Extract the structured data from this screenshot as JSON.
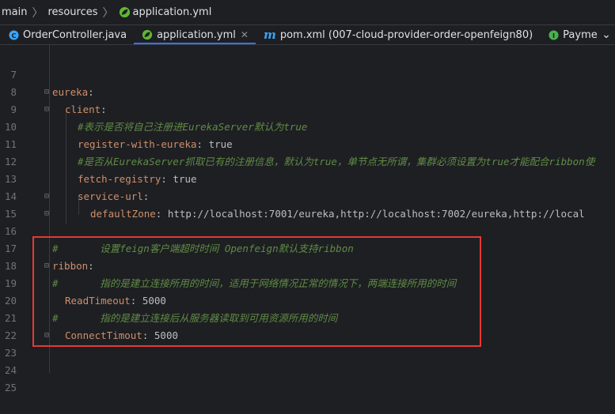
{
  "breadcrumb": {
    "items": [
      "main",
      "resources",
      "application.yml"
    ]
  },
  "tabs": [
    {
      "label": "OrderController.java",
      "icon": "java-class-icon",
      "active": false
    },
    {
      "label": "application.yml",
      "icon": "spring-leaf-icon",
      "active": true
    },
    {
      "label": "pom.xml (007-cloud-provider-order-openfeign80)",
      "icon": "maven-icon",
      "active": false
    },
    {
      "label": "PaymentFeign",
      "icon": "interface-icon",
      "active": false
    }
  ],
  "lines": [
    {
      "n": "7"
    },
    {
      "n": "8"
    },
    {
      "n": "9",
      "key": "eureka",
      "sep": ":"
    },
    {
      "n": "10",
      "key": "client",
      "sep": ":"
    },
    {
      "n": "11",
      "comment": "#表示是否将自己注册进EurekaServer默认为true"
    },
    {
      "n": "12",
      "key": "register-with-eureka",
      "sep": ": ",
      "value": "true"
    },
    {
      "n": "13",
      "comment": "#是否从EurekaServer抓取已有的注册信息，默认为true，单节点无所谓，集群必须设置为true才能配合ribbon使"
    },
    {
      "n": "14",
      "key": "fetch-registry",
      "sep": ": ",
      "value": "true"
    },
    {
      "n": "15",
      "key": "service-url",
      "sep": ":"
    },
    {
      "n": "16",
      "key": "defaultZone",
      "sep": ": ",
      "value": "http://localhost:7001/eureka,http://localhost:7002/eureka,http://local"
    },
    {
      "n": "17"
    },
    {
      "n": "18",
      "comment": "#       设置feign客户端超时时间 Openfeign默认支持ribbon"
    },
    {
      "n": "19",
      "key": "ribbon",
      "sep": ":"
    },
    {
      "n": "20",
      "comment": "#       指的是建立连接所用的时间，适用于网络情况正常的情况下，两端连接所用的时间"
    },
    {
      "n": "21",
      "key": "ReadTimeout",
      "sep": ": ",
      "value": "5000"
    },
    {
      "n": "22",
      "comment": "#       指的是建立连接后从服务器读取到可用资源所用的时间"
    },
    {
      "n": "23",
      "key": "ConnectTimout",
      "sep": ": ",
      "value": "5000"
    },
    {
      "n": "24"
    },
    {
      "n": "25"
    }
  ],
  "colors": {
    "key": "#cf8e6d",
    "comment": "#5f8c46",
    "highlight_box": "#e53935",
    "active_tab": "#3574f0"
  }
}
